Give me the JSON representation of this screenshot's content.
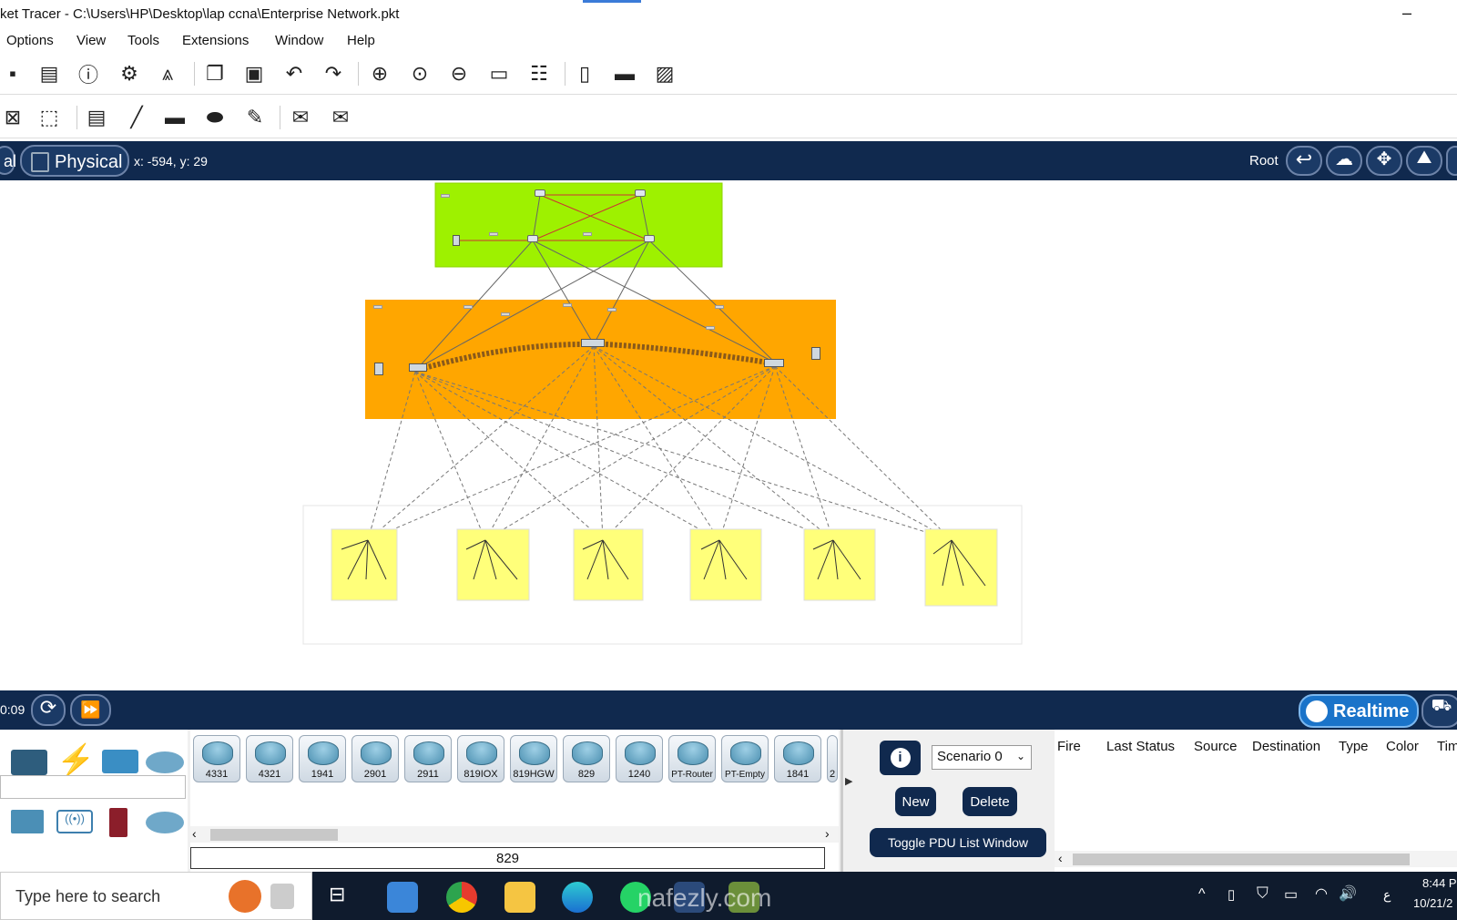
{
  "window": {
    "title": "ket Tracer - C:\\Users\\HP\\Desktop\\lap ccna\\Enterprise Network.pkt",
    "minimize": "–"
  },
  "menu": [
    "Options",
    "View",
    "Tools",
    "Extensions",
    "Window",
    "Help"
  ],
  "toolbar1_icons": [
    "save-icon",
    "print-icon",
    "info-icon",
    "network-wizard-icon",
    "activity-wizard-icon",
    "copy-icon",
    "paste-icon",
    "undo-icon",
    "redo-icon",
    "zoom-in-icon",
    "zoom-reset-icon",
    "zoom-out-icon",
    "rectangle-view-icon",
    "palette-icon",
    "custom-device-icon",
    "viewport-icon",
    "image-icon"
  ],
  "toolbar2_icons": [
    "delete-icon",
    "select-icon",
    "note-icon",
    "line-icon",
    "rectangle-icon",
    "ellipse-icon",
    "freeform-icon",
    "add-simple-pdu-icon",
    "add-complex-pdu-icon"
  ],
  "modebar": {
    "logical_tab": "al",
    "physical_tab": "Physical",
    "coords": "x: -594, y: 29",
    "root": "Root"
  },
  "canvas": {
    "colors": {
      "core": "#99f000",
      "distribution": "#ffa500",
      "access": "#ffff7a"
    },
    "access_blocks": 6
  },
  "simbar": {
    "time": "0:09",
    "mode": "Realtime"
  },
  "device_categories": [
    "network-devices-icon",
    "connections-icon",
    "components-icon",
    "cloud-icon",
    "switch-icon",
    "wireless-icon",
    "security-icon",
    "wan-cloud-icon"
  ],
  "devices": [
    "4331",
    "4321",
    "1941",
    "2901",
    "2911",
    "819IOX",
    "819HGW",
    "829",
    "1240",
    "PT-Router",
    "PT-Empty",
    "1841",
    "2"
  ],
  "selected_device": "829",
  "scenario": {
    "value": "Scenario 0",
    "new": "New",
    "delete": "Delete",
    "toggle": "Toggle PDU List Window"
  },
  "pdu_columns": [
    "Fire",
    "Last Status",
    "Source",
    "Destination",
    "Type",
    "Color",
    "Tim"
  ],
  "taskbar": {
    "search_placeholder": "Type here to search",
    "time": "8:44 P",
    "date": "10/21/2",
    "lang": "ع",
    "watermark": "nafezly.com"
  },
  "accent_color": "#10294e"
}
